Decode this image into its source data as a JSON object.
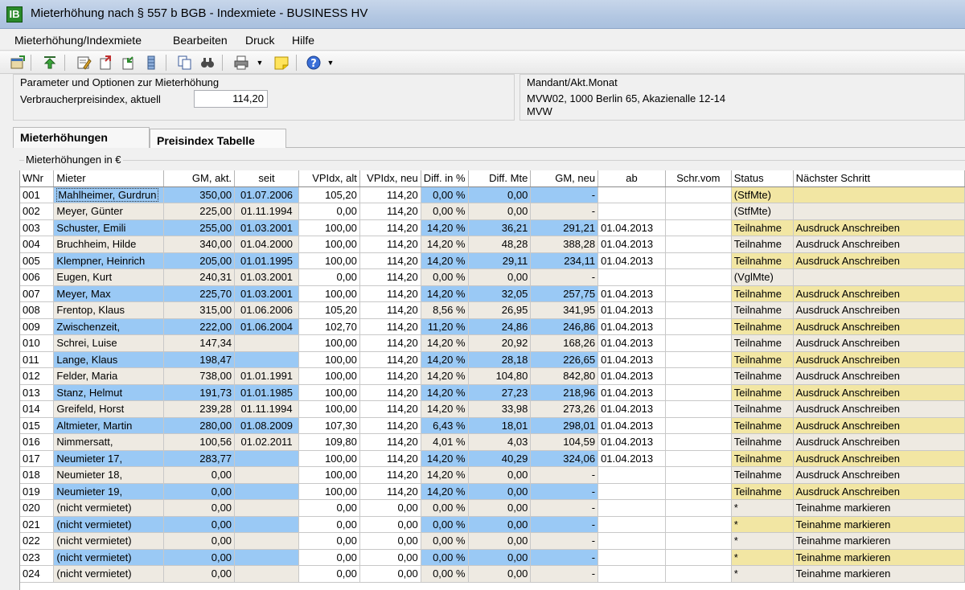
{
  "window": {
    "title": "Mieterhöhung nach § 557 b BGB - Indexmiete - BUSINESS HV",
    "app_icon_glyph": "IB"
  },
  "menu": [
    "Mieterhöhung/Indexmiete",
    "Bearbeiten",
    "Druck",
    "Hilfe"
  ],
  "toolbar": {
    "icons": [
      "properties-icon",
      "up-arrow-icon",
      "edit-icon",
      "export-icon",
      "import-icon",
      "archive-icon",
      "copy-icon",
      "find-icon",
      "print-icon",
      "note-icon",
      "help-icon"
    ]
  },
  "params": {
    "title": "Parameter und Optionen zur Mieterhöhung",
    "vpi_label": "Verbraucherpreisindex, aktuell",
    "vpi_value": "114,20"
  },
  "mandant": {
    "title": "Mandant/Akt.Monat",
    "line1": "MVW02, 1000 Berlin 65, Akazienalle 12-14",
    "line2": "MVW"
  },
  "tabs": [
    "Mieterhöhungen",
    "Preisindex Tabelle"
  ],
  "group_title": "Mieterhöhungen in €",
  "columns": [
    "WNr",
    "Mieter",
    "GM, akt.",
    "seit",
    "VPIdx, alt",
    "VPIdx, neu",
    "Diff. in %",
    "Diff. Mte",
    "GM, neu",
    "ab",
    "Schr.vom",
    "Status",
    "Nächster Schritt"
  ],
  "rows": [
    {
      "wnr": "001",
      "mieter": "Mahlheimer, Gurdrun",
      "gm_akt": "350,00",
      "seit": "01.07.2006",
      "vpi_alt": "105,20",
      "vpi_neu": "114,20",
      "diff_pct": "0,00 %",
      "diff_mte": "0,00",
      "gm_neu": "-",
      "ab": "",
      "schr": "",
      "status": "(StfMte)",
      "next": "",
      "style": "blue"
    },
    {
      "wnr": "002",
      "mieter": "Meyer, Günter",
      "gm_akt": "225,00",
      "seit": "01.11.1994",
      "vpi_alt": "0,00",
      "vpi_neu": "114,20",
      "diff_pct": "0,00 %",
      "diff_mte": "0,00",
      "gm_neu": "-",
      "ab": "",
      "schr": "",
      "status": "(StfMte)",
      "next": "",
      "style": "gray"
    },
    {
      "wnr": "003",
      "mieter": "Schuster, Emili",
      "gm_akt": "255,00",
      "seit": "01.03.2001",
      "vpi_alt": "100,00",
      "vpi_neu": "114,20",
      "diff_pct": "14,20 %",
      "diff_mte": "36,21",
      "gm_neu": "291,21",
      "ab": "01.04.2013",
      "schr": "",
      "status": "Teilnahme",
      "next": "Ausdruck Anschreiben",
      "style": "blue"
    },
    {
      "wnr": "004",
      "mieter": "Bruchheim, Hilde",
      "gm_akt": "340,00",
      "seit": "01.04.2000",
      "vpi_alt": "100,00",
      "vpi_neu": "114,20",
      "diff_pct": "14,20 %",
      "diff_mte": "48,28",
      "gm_neu": "388,28",
      "ab": "01.04.2013",
      "schr": "",
      "status": "Teilnahme",
      "next": "Ausdruck Anschreiben",
      "style": "gray"
    },
    {
      "wnr": "005",
      "mieter": "Klempner, Heinrich",
      "gm_akt": "205,00",
      "seit": "01.01.1995",
      "vpi_alt": "100,00",
      "vpi_neu": "114,20",
      "diff_pct": "14,20 %",
      "diff_mte": "29,11",
      "gm_neu": "234,11",
      "ab": "01.04.2013",
      "schr": "",
      "status": "Teilnahme",
      "next": "Ausdruck Anschreiben",
      "style": "blue"
    },
    {
      "wnr": "006",
      "mieter": "Eugen, Kurt",
      "gm_akt": "240,31",
      "seit": "01.03.2001",
      "vpi_alt": "0,00",
      "vpi_neu": "114,20",
      "diff_pct": "0,00 %",
      "diff_mte": "0,00",
      "gm_neu": "-",
      "ab": "",
      "schr": "",
      "status": "(VglMte)",
      "next": "",
      "style": "gray"
    },
    {
      "wnr": "007",
      "mieter": "Meyer, Max",
      "gm_akt": "225,70",
      "seit": "01.03.2001",
      "vpi_alt": "100,00",
      "vpi_neu": "114,20",
      "diff_pct": "14,20 %",
      "diff_mte": "32,05",
      "gm_neu": "257,75",
      "ab": "01.04.2013",
      "schr": "",
      "status": "Teilnahme",
      "next": "Ausdruck Anschreiben",
      "style": "blue"
    },
    {
      "wnr": "008",
      "mieter": "Frentop, Klaus",
      "gm_akt": "315,00",
      "seit": "01.06.2006",
      "vpi_alt": "105,20",
      "vpi_neu": "114,20",
      "diff_pct": "8,56 %",
      "diff_mte": "26,95",
      "gm_neu": "341,95",
      "ab": "01.04.2013",
      "schr": "",
      "status": "Teilnahme",
      "next": "Ausdruck Anschreiben",
      "style": "gray"
    },
    {
      "wnr": "009",
      "mieter": "Zwischenzeit,",
      "gm_akt": "222,00",
      "seit": "01.06.2004",
      "vpi_alt": "102,70",
      "vpi_neu": "114,20",
      "diff_pct": "11,20 %",
      "diff_mte": "24,86",
      "gm_neu": "246,86",
      "ab": "01.04.2013",
      "schr": "",
      "status": "Teilnahme",
      "next": "Ausdruck Anschreiben",
      "style": "blue"
    },
    {
      "wnr": "010",
      "mieter": "Schrei, Luise",
      "gm_akt": "147,34",
      "seit": "",
      "vpi_alt": "100,00",
      "vpi_neu": "114,20",
      "diff_pct": "14,20 %",
      "diff_mte": "20,92",
      "gm_neu": "168,26",
      "ab": "01.04.2013",
      "schr": "",
      "status": "Teilnahme",
      "next": "Ausdruck Anschreiben",
      "style": "gray"
    },
    {
      "wnr": "011",
      "mieter": "Lange, Klaus",
      "gm_akt": "198,47",
      "seit": "",
      "vpi_alt": "100,00",
      "vpi_neu": "114,20",
      "diff_pct": "14,20 %",
      "diff_mte": "28,18",
      "gm_neu": "226,65",
      "ab": "01.04.2013",
      "schr": "",
      "status": "Teilnahme",
      "next": "Ausdruck Anschreiben",
      "style": "blue"
    },
    {
      "wnr": "012",
      "mieter": "Felder, Maria",
      "gm_akt": "738,00",
      "seit": "01.01.1991",
      "vpi_alt": "100,00",
      "vpi_neu": "114,20",
      "diff_pct": "14,20 %",
      "diff_mte": "104,80",
      "gm_neu": "842,80",
      "ab": "01.04.2013",
      "schr": "",
      "status": "Teilnahme",
      "next": "Ausdruck Anschreiben",
      "style": "gray"
    },
    {
      "wnr": "013",
      "mieter": "Stanz, Helmut",
      "gm_akt": "191,73",
      "seit": "01.01.1985",
      "vpi_alt": "100,00",
      "vpi_neu": "114,20",
      "diff_pct": "14,20 %",
      "diff_mte": "27,23",
      "gm_neu": "218,96",
      "ab": "01.04.2013",
      "schr": "",
      "status": "Teilnahme",
      "next": "Ausdruck Anschreiben",
      "style": "blue"
    },
    {
      "wnr": "014",
      "mieter": "Greifeld, Horst",
      "gm_akt": "239,28",
      "seit": "01.11.1994",
      "vpi_alt": "100,00",
      "vpi_neu": "114,20",
      "diff_pct": "14,20 %",
      "diff_mte": "33,98",
      "gm_neu": "273,26",
      "ab": "01.04.2013",
      "schr": "",
      "status": "Teilnahme",
      "next": "Ausdruck Anschreiben",
      "style": "gray"
    },
    {
      "wnr": "015",
      "mieter": "Altmieter, Martin",
      "gm_akt": "280,00",
      "seit": "01.08.2009",
      "vpi_alt": "107,30",
      "vpi_neu": "114,20",
      "diff_pct": "6,43 %",
      "diff_mte": "18,01",
      "gm_neu": "298,01",
      "ab": "01.04.2013",
      "schr": "",
      "status": "Teilnahme",
      "next": "Ausdruck Anschreiben",
      "style": "blue"
    },
    {
      "wnr": "016",
      "mieter": "Nimmersatt,",
      "gm_akt": "100,56",
      "seit": "01.02.2011",
      "vpi_alt": "109,80",
      "vpi_neu": "114,20",
      "diff_pct": "4,01 %",
      "diff_mte": "4,03",
      "gm_neu": "104,59",
      "ab": "01.04.2013",
      "schr": "",
      "status": "Teilnahme",
      "next": "Ausdruck Anschreiben",
      "style": "gray"
    },
    {
      "wnr": "017",
      "mieter": "Neumieter 17,",
      "gm_akt": "283,77",
      "seit": "",
      "vpi_alt": "100,00",
      "vpi_neu": "114,20",
      "diff_pct": "14,20 %",
      "diff_mte": "40,29",
      "gm_neu": "324,06",
      "ab": "01.04.2013",
      "schr": "",
      "status": "Teilnahme",
      "next": "Ausdruck Anschreiben",
      "style": "blue"
    },
    {
      "wnr": "018",
      "mieter": "Neumieter 18,",
      "gm_akt": "0,00",
      "seit": "",
      "vpi_alt": "100,00",
      "vpi_neu": "114,20",
      "diff_pct": "14,20 %",
      "diff_mte": "0,00",
      "gm_neu": "-",
      "ab": "",
      "schr": "",
      "status": "Teilnahme",
      "next": "Ausdruck Anschreiben",
      "style": "gray"
    },
    {
      "wnr": "019",
      "mieter": "Neumieter 19,",
      "gm_akt": "0,00",
      "seit": "",
      "vpi_alt": "100,00",
      "vpi_neu": "114,20",
      "diff_pct": "14,20 %",
      "diff_mte": "0,00",
      "gm_neu": "-",
      "ab": "",
      "schr": "",
      "status": "Teilnahme",
      "next": "Ausdruck Anschreiben",
      "style": "blue"
    },
    {
      "wnr": "020",
      "mieter": "(nicht vermietet)",
      "gm_akt": "0,00",
      "seit": "",
      "vpi_alt": "0,00",
      "vpi_neu": "0,00",
      "diff_pct": "0,00 %",
      "diff_mte": "0,00",
      "gm_neu": "-",
      "ab": "",
      "schr": "",
      "status": "*",
      "next": "Teinahme markieren",
      "style": "gray"
    },
    {
      "wnr": "021",
      "mieter": "(nicht vermietet)",
      "gm_akt": "0,00",
      "seit": "",
      "vpi_alt": "0,00",
      "vpi_neu": "0,00",
      "diff_pct": "0,00 %",
      "diff_mte": "0,00",
      "gm_neu": "-",
      "ab": "",
      "schr": "",
      "status": "*",
      "next": "Teinahme markieren",
      "style": "blue"
    },
    {
      "wnr": "022",
      "mieter": "(nicht vermietet)",
      "gm_akt": "0,00",
      "seit": "",
      "vpi_alt": "0,00",
      "vpi_neu": "0,00",
      "diff_pct": "0,00 %",
      "diff_mte": "0,00",
      "gm_neu": "-",
      "ab": "",
      "schr": "",
      "status": "*",
      "next": "Teinahme markieren",
      "style": "gray"
    },
    {
      "wnr": "023",
      "mieter": "(nicht vermietet)",
      "gm_akt": "0,00",
      "seit": "",
      "vpi_alt": "0,00",
      "vpi_neu": "0,00",
      "diff_pct": "0,00 %",
      "diff_mte": "0,00",
      "gm_neu": "-",
      "ab": "",
      "schr": "",
      "status": "*",
      "next": "Teinahme markieren",
      "style": "blue"
    },
    {
      "wnr": "024",
      "mieter": "(nicht vermietet)",
      "gm_akt": "0,00",
      "seit": "",
      "vpi_alt": "0,00",
      "vpi_neu": "0,00",
      "diff_pct": "0,00 %",
      "diff_mte": "0,00",
      "gm_neu": "-",
      "ab": "",
      "schr": "",
      "status": "*",
      "next": "Teinahme markieren",
      "style": "gray"
    }
  ]
}
